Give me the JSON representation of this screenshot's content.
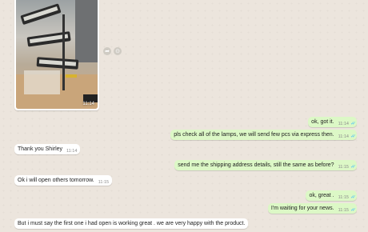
{
  "media": {
    "time": "11:14",
    "forward_icon": "forward-icon",
    "save_icon": "download-icon"
  },
  "messages": [
    {
      "dir": "out",
      "text": "ok, got it.",
      "time": "11:14"
    },
    {
      "dir": "out",
      "text": "pls check all of the lamps,  we will send few pcs via express then.",
      "time": "11:14"
    },
    {
      "dir": "in",
      "text": "Thank you Shirley",
      "time": "11:14"
    },
    {
      "dir": "out",
      "text": "send me the shipping address details, still the same as before?",
      "time": "11:15"
    },
    {
      "dir": "in",
      "text": "Ok i will open others tomorrow.",
      "time": "11:15"
    },
    {
      "dir": "out",
      "text": "ok, great .",
      "time": "11:15"
    },
    {
      "dir": "out",
      "text": "I'm waiting for your news.",
      "time": "11:15"
    },
    {
      "dir": "in",
      "text": "But i must say the first  one i had open is working great . we are very happy with the product.",
      "time": ""
    }
  ],
  "colors": {
    "outgoing": "#dcf8c6",
    "incoming": "#ffffff",
    "background": "#ece5dd",
    "read_ticks": "#4fc3f7"
  }
}
